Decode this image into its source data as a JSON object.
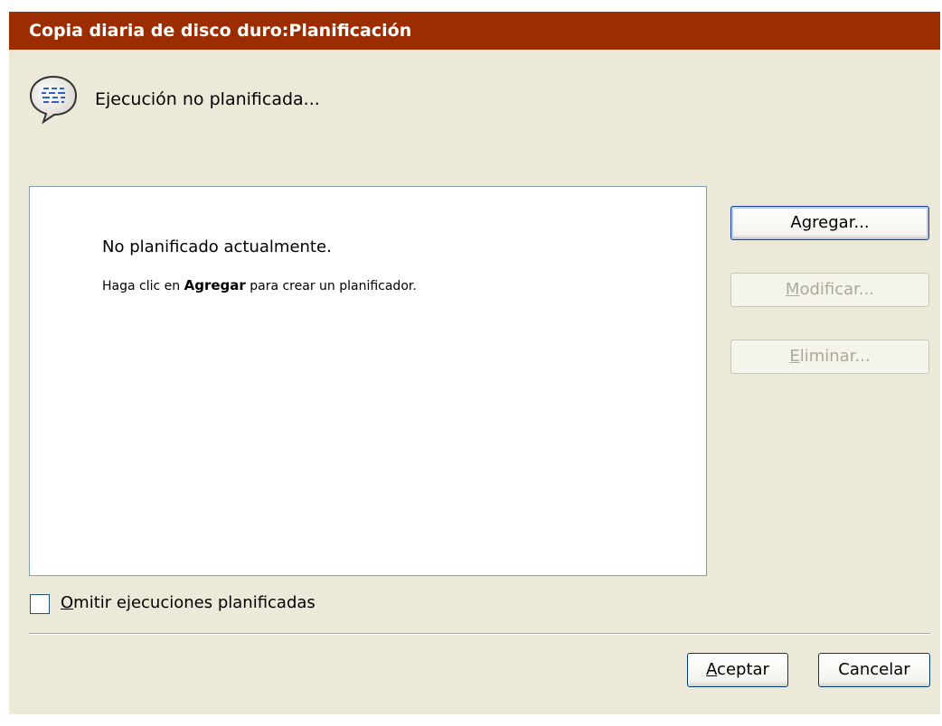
{
  "window": {
    "title": "Copia diaria de disco duro:Planificación"
  },
  "status": {
    "icon": "speech-bubble-icon",
    "text": "Ejecución no planificada..."
  },
  "schedule_panel": {
    "line1": "No planificado actualmente.",
    "line2_prefix": "Haga clic en ",
    "line2_bold": "Agregar",
    "line2_suffix": " para crear un planificador."
  },
  "side_buttons": {
    "add": {
      "pre": "A",
      "key": "g",
      "post": "regar...",
      "enabled": true
    },
    "modify": {
      "pre": "",
      "key": "M",
      "post": "odificar...",
      "enabled": false
    },
    "delete": {
      "pre": "",
      "key": "E",
      "post": "liminar...",
      "enabled": false
    }
  },
  "skip_checkbox": {
    "checked": false,
    "key": "O",
    "post": "mitir ejecuciones planificadas"
  },
  "footer": {
    "ok": {
      "key": "A",
      "post": "ceptar"
    },
    "cancel": "Cancelar"
  },
  "colors": {
    "titlebar": "#9C2D00",
    "dialog_bg": "#ECE9D8",
    "disabled_text": "#ACA899"
  }
}
